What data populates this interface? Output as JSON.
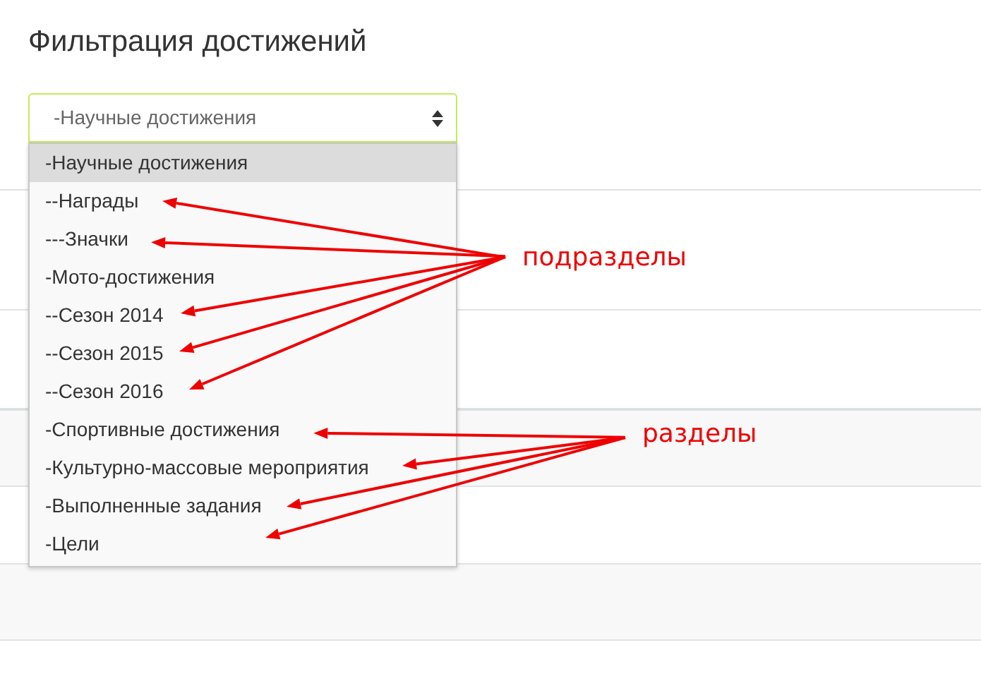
{
  "title": "Фильтрация достижений",
  "select": {
    "value": "-Научные достижения",
    "open": true
  },
  "options": [
    {
      "label": "-Научные достижения",
      "selected": true,
      "kind": "plain"
    },
    {
      "label": "--Награды",
      "selected": false,
      "kind": "sub"
    },
    {
      "label": "---Значки",
      "selected": false,
      "kind": "sub"
    },
    {
      "label": "-Мото-достижения",
      "selected": false,
      "kind": "plain"
    },
    {
      "label": "--Сезон 2014",
      "selected": false,
      "kind": "sub"
    },
    {
      "label": "--Сезон 2015",
      "selected": false,
      "kind": "sub"
    },
    {
      "label": "--Сезон 2016",
      "selected": false,
      "kind": "sub"
    },
    {
      "label": "-Спортивные достижения",
      "selected": false,
      "kind": "sec"
    },
    {
      "label": "-Культурно-массовые мероприятия",
      "selected": false,
      "kind": "sec"
    },
    {
      "label": "-Выполненные задания",
      "selected": false,
      "kind": "sec"
    },
    {
      "label": "-Цели",
      "selected": false,
      "kind": "sec"
    }
  ],
  "annotations": [
    {
      "kind": "sub",
      "label": "подразделы"
    },
    {
      "kind": "sec",
      "label": "разделы"
    }
  ]
}
